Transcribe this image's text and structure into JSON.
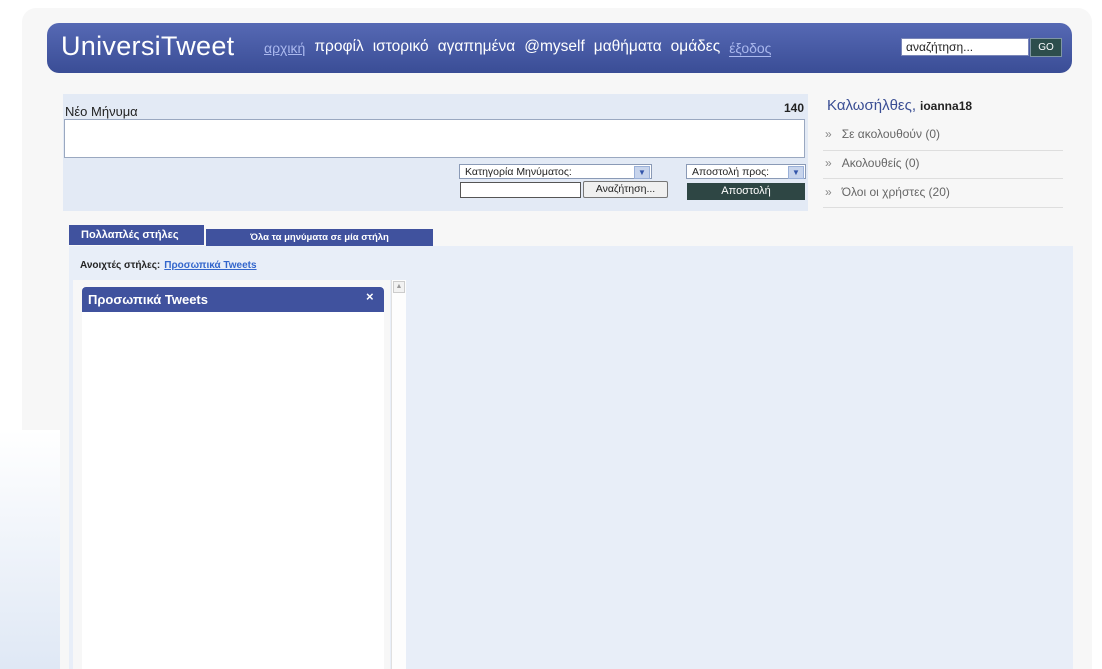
{
  "header": {
    "logo": "UniversiTweet",
    "nav": [
      "αρχική",
      "προφίλ",
      "ιστορικό",
      "αγαπημένα",
      "@myself",
      "μαθήματα",
      "ομάδες",
      "έξοδος"
    ],
    "search_placeholder": "αναζήτηση...",
    "go_label": "GO"
  },
  "compose": {
    "title": "Νέο Μήνυμα",
    "char_count": "140",
    "category_select": "Κατηγορία Μηνύματος:",
    "recipient_select": "Αποστολή προς:",
    "search_button": "Αναζήτηση...",
    "send_button": "Αποστολή"
  },
  "sidebar": {
    "welcome": "Καλωσήλθες,",
    "username": "ioanna18",
    "bullet": "»",
    "items": [
      "Σε ακολουθούν (0)",
      "Ακολουθείς (0)",
      "Όλοι οι χρήστες (20)"
    ]
  },
  "tabs": {
    "multi": "Πολλαπλές στήλες",
    "single": "Όλα τα μηνύματα σε μία στήλη"
  },
  "columns": {
    "open_label": "Ανοιχτές στήλες:",
    "open_link": "Προσωπικά Tweets",
    "column_title": "Προσωπικά Tweets",
    "close_symbol": "×"
  },
  "colors": {
    "header": "#4a5da8",
    "tab": "#40529e",
    "send_button": "#2e4644"
  }
}
